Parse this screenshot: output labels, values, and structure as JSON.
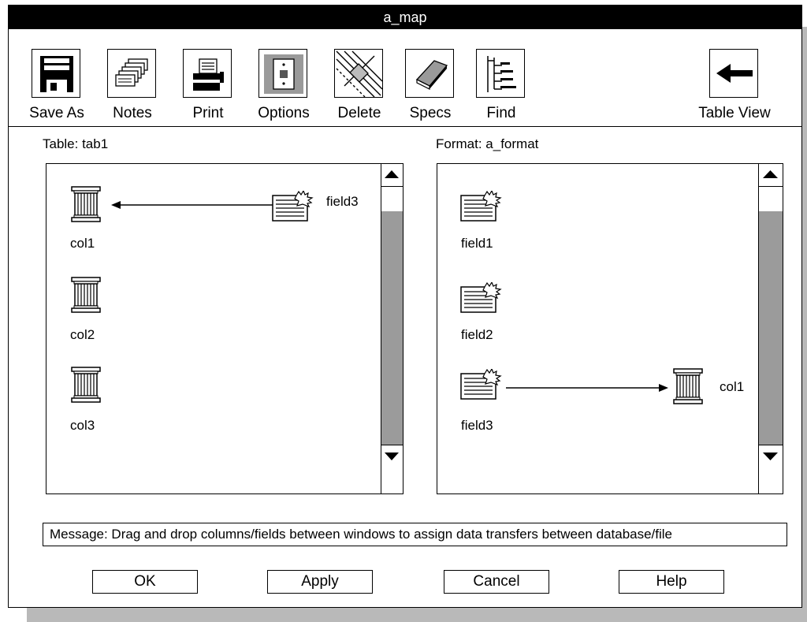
{
  "window": {
    "title": "a_map"
  },
  "toolbar": {
    "save_as": "Save As",
    "notes": "Notes",
    "print": "Print",
    "options": "Options",
    "delete": "Delete",
    "specs": "Specs",
    "find": "Find",
    "table_view": "Table View"
  },
  "left_panel": {
    "label": "Table: tab1",
    "items": [
      "col1",
      "col2",
      "col3"
    ],
    "dragged_field": "field3"
  },
  "right_panel": {
    "label": "Format: a_format",
    "items": [
      "field1",
      "field2",
      "field3"
    ],
    "dragged_column": "col1"
  },
  "message": "Message:  Drag and drop columns/fields between windows to assign data transfers between database/file",
  "buttons": {
    "ok": "OK",
    "apply": "Apply",
    "cancel": "Cancel",
    "help": "Help"
  }
}
